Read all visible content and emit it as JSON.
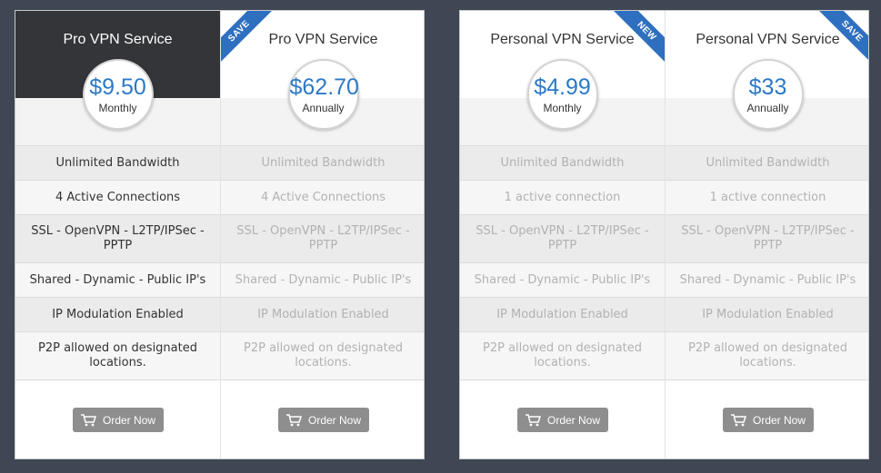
{
  "plans": [
    {
      "title": "Pro VPN Service",
      "price": "$9.50",
      "period": "Monthly",
      "ribbon": "",
      "features": [
        "Unlimited Bandwidth",
        "4 Active Connections",
        "SSL - OpenVPN - L2TP/IPSec - PPTP",
        "Shared - Dynamic - Public IP's",
        "IP Modulation Enabled",
        "P2P allowed on designated locations."
      ],
      "order_label": "Order Now"
    },
    {
      "title": "Pro VPN Service",
      "price": "$62.70",
      "period": "Annually",
      "ribbon": "SAVE",
      "features": [
        "Unlimited Bandwidth",
        "4 Active Connections",
        "SSL - OpenVPN - L2TP/IPSec - PPTP",
        "Shared - Dynamic - Public IP's",
        "IP Modulation Enabled",
        "P2P allowed on designated locations."
      ],
      "order_label": "Order Now"
    },
    {
      "title": "Personal VPN Service",
      "price": "$4.99",
      "period": "Monthly",
      "ribbon": "NEW",
      "features": [
        "Unlimited Bandwidth",
        "1 active connection",
        "SSL - OpenVPN - L2TP/IPSec - PPTP",
        "Shared - Dynamic - Public IP's",
        "IP Modulation Enabled",
        "P2P allowed on designated locations."
      ],
      "order_label": "Order Now"
    },
    {
      "title": "Personal VPN Service",
      "price": "$33",
      "period": "Annually",
      "ribbon": "SAVE",
      "features": [
        "Unlimited Bandwidth",
        "1 active connection",
        "SSL - OpenVPN - L2TP/IPSec - PPTP",
        "Shared - Dynamic - Public IP's",
        "IP Modulation Enabled",
        "P2P allowed on designated locations."
      ],
      "order_label": "Order Now"
    }
  ],
  "icons": {
    "order": "shopping-cart-icon"
  },
  "colors": {
    "price": "#2d79c6",
    "ribbon": "#2f6fbf",
    "featured_header": "#333538",
    "order_button": "#8e8e8e",
    "background": "#3e4753"
  }
}
